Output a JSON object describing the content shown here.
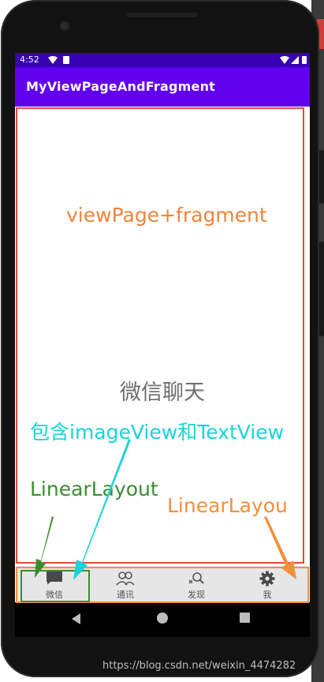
{
  "status_bar": {
    "time": "4:52"
  },
  "app_bar": {
    "title": "MyViewPageAndFragment"
  },
  "content": {
    "center_text": "微信聊天"
  },
  "tabs": [
    {
      "label": "微信",
      "icon": "chat-icon",
      "selected": true
    },
    {
      "label": "通讯",
      "icon": "contacts-icon",
      "selected": false
    },
    {
      "label": "发现",
      "icon": "discover-icon",
      "selected": false
    },
    {
      "label": "我",
      "icon": "gear-icon",
      "selected": false
    }
  ],
  "annotations": {
    "viewpage": "viewPage+fragment",
    "contains": "包含imageView和TextView",
    "linear_layout_1": "LinearLayout",
    "linear_layout_2": "LinearLayou"
  },
  "watermark": "https://blog.csdn.net/weixin_4474282",
  "colors": {
    "statusbar": "#3700b3",
    "appbar": "#6200ee",
    "tabbar": "#e6e6e6",
    "annotation_red": "#e5483d",
    "annotation_green": "#3d8b33",
    "annotation_orange": "#f0903c",
    "annotation_cyan": "#1ad3d8"
  }
}
